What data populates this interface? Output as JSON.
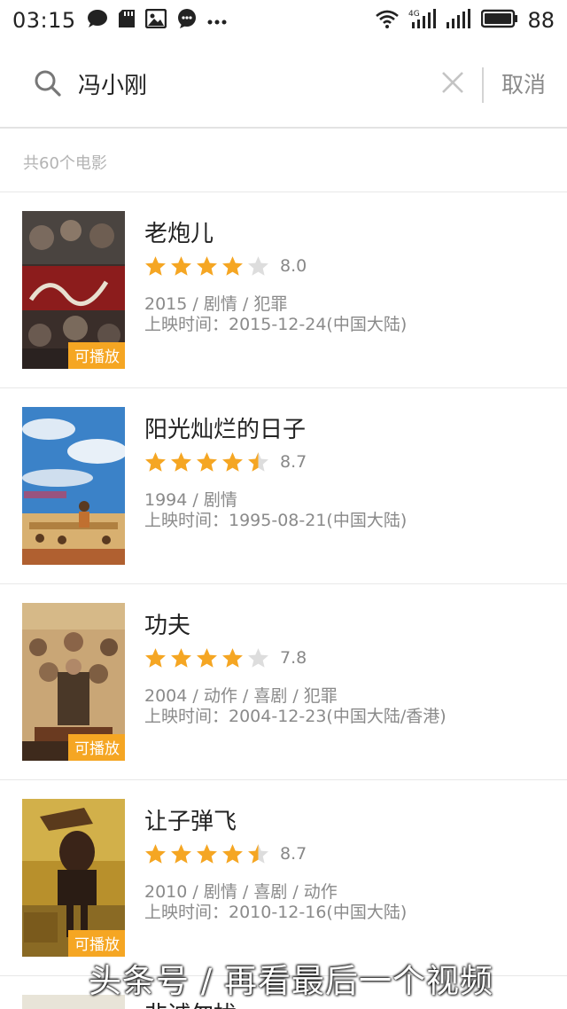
{
  "status_bar": {
    "time": "03:15",
    "battery": "88",
    "network": "4G"
  },
  "search": {
    "query": "冯小刚",
    "cancel_label": "取消"
  },
  "results": {
    "count_text": "共60个电影"
  },
  "movies": [
    {
      "title": "老炮儿",
      "rating": 8.0,
      "rating_text": "8.0",
      "stars": 4,
      "meta": "2015 / 剧情 / 犯罪",
      "release": "上映时间：2015-12-24(中国大陆)",
      "playable": true
    },
    {
      "title": "阳光灿烂的日子",
      "rating": 8.7,
      "rating_text": "8.7",
      "stars": 4.5,
      "meta": "1994 / 剧情",
      "release": "上映时间：1995-08-21(中国大陆)",
      "playable": false
    },
    {
      "title": "功夫",
      "rating": 7.8,
      "rating_text": "7.8",
      "stars": 4,
      "meta": "2004 / 动作 / 喜剧 / 犯罪",
      "release": "上映时间：2004-12-23(中国大陆/香港)",
      "playable": true
    },
    {
      "title": "让子弹飞",
      "rating": 8.7,
      "rating_text": "8.7",
      "stars": 4.5,
      "meta": "2010 / 剧情 / 喜剧 / 动作",
      "release": "上映时间：2010-12-16(中国大陆)",
      "playable": true
    }
  ],
  "play_badge_label": "可播放",
  "partial_movie_title": "非诚勿扰",
  "watermark": "头条号 / 再看最后一个视频",
  "colors": {
    "star": "#f5a623",
    "star_empty": "#dddddd",
    "badge": "#f5a623"
  }
}
